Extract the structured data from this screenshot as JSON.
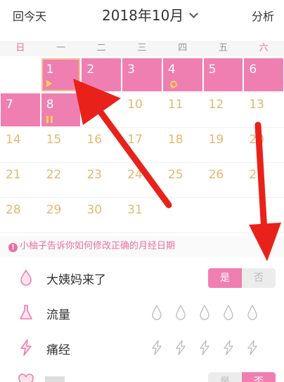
{
  "header": {
    "back_today": "回今天",
    "title": "2018年10月",
    "analysis": "分析"
  },
  "weekdays": [
    "日",
    "一",
    "二",
    "三",
    "四",
    "五",
    "六"
  ],
  "calendar": {
    "weeks": [
      [
        "",
        "1",
        "2",
        "3",
        "4",
        "5",
        "6"
      ],
      [
        "7",
        "8",
        "9",
        "10",
        "11",
        "12",
        "13"
      ],
      [
        "14",
        "15",
        "16",
        "17",
        "18",
        "19",
        "20"
      ],
      [
        "21",
        "22",
        "23",
        "24",
        "25",
        "26",
        "27"
      ],
      [
        "28",
        "29",
        "30",
        "31",
        "",
        "",
        ""
      ]
    ],
    "period_days": [
      "1",
      "2",
      "3",
      "4",
      "5",
      "6",
      "7",
      "8"
    ],
    "selected_day": "1"
  },
  "tip": "小柚子告诉你如何修改正确的月经日期",
  "options": {
    "period_came": {
      "label": "大姨妈来了",
      "yes": "是",
      "no": "否"
    },
    "flow": {
      "label": "流量"
    },
    "cramps": {
      "label": "痛经"
    },
    "hidden_row": {
      "yes": "是",
      "no": "否"
    }
  },
  "colors": {
    "accent": "#ef7fb1",
    "date_text": "#e3b96f",
    "arrow": "#e8221b"
  }
}
